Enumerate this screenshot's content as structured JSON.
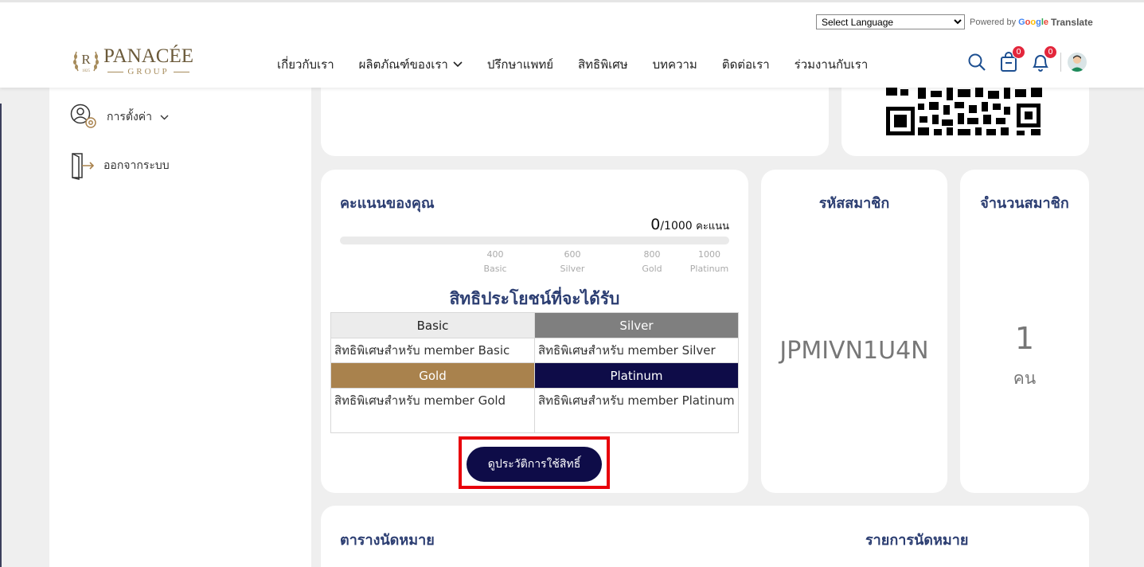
{
  "header": {
    "language_select": "Select Language",
    "powered_by": "Powered by",
    "google": "Google",
    "translate": "Translate",
    "logo_main": "PANACÉE",
    "logo_sub": "GROUP",
    "nav": [
      "เกี่ยวกับเรา",
      "ผลิตภัณฑ์ของเรา",
      "ปรึกษาแพทย์",
      "สิทธิพิเศษ",
      "บทความ",
      "ติดต่อเรา",
      "ร่วมงานกับเรา"
    ],
    "cart_count": "0",
    "notif_count": "0"
  },
  "sidebar": {
    "settings_label": "การตั้งค่า",
    "logout_label": "ออกจากระบบ"
  },
  "score": {
    "title": "คะแนนของคุณ",
    "current": "0",
    "max": "/1000",
    "unit": "คะแนน",
    "progress": 0,
    "ticks": [
      {
        "value": "400",
        "label": "Basic"
      },
      {
        "value": "600",
        "label": "Silver"
      },
      {
        "value": "800",
        "label": "Gold"
      },
      {
        "value": "1000",
        "label": "Platinum"
      }
    ],
    "benefits_title": "สิทธิประโยชน์ที่จะได้รับ",
    "tiers": {
      "basic": {
        "name": "Basic",
        "desc": "สิทธิพิเศษสำหรับ member Basic"
      },
      "silver": {
        "name": "Silver",
        "desc": "สิทธิพิเศษสำหรับ member Silver"
      },
      "gold": {
        "name": "Gold",
        "desc": "สิทธิพิเศษสำหรับ member Gold"
      },
      "platinum": {
        "name": "Platinum",
        "desc": "สิทธิพิเศษสำหรับ member Platinum"
      }
    },
    "history_button": "ดูประวัติการใช้สิทธิ์"
  },
  "member": {
    "title": "รหัสสมาชิก",
    "code": "JPMIVN1U4N"
  },
  "members_count": {
    "title": "จำนวนสมาชิก",
    "count": "1",
    "unit": "คน"
  },
  "appointments": {
    "schedule_title": "ตารางนัดหมาย",
    "list_title": "รายการนัดหมาย"
  },
  "colors": {
    "navy": "#0e0c48",
    "gold": "#a9824d",
    "silver": "#7f7f7f",
    "highlight": "#e8000b",
    "badge": "#e3263b"
  }
}
